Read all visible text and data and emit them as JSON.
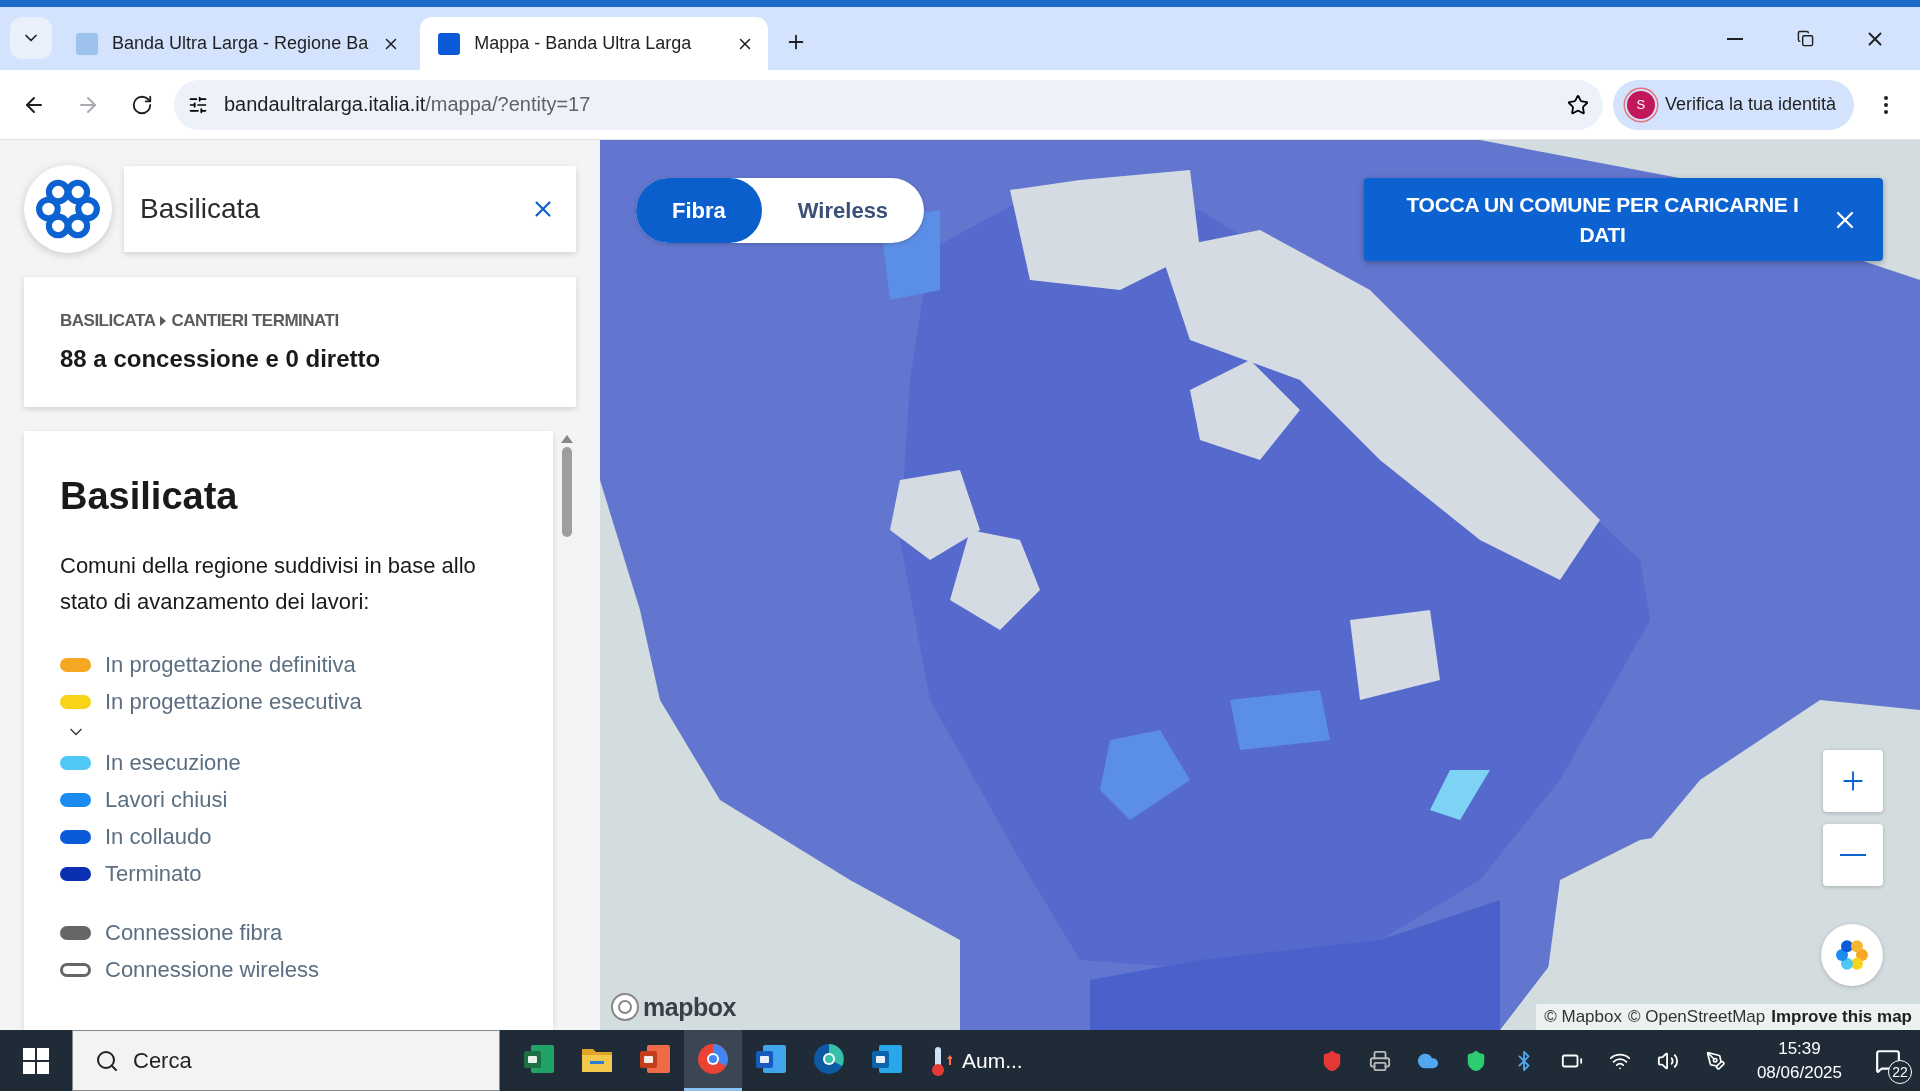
{
  "browser": {
    "tabs": [
      {
        "title": "Banda Ultra Larga - Regione Ba",
        "selected": false
      },
      {
        "title": "Mappa - Banda Ultra Larga",
        "selected": true
      }
    ],
    "url_host": "bandaultralarga.italia.it",
    "url_path": "/mappa/?entity=17",
    "forward_disabled": true,
    "profile": {
      "initial": "S",
      "label": "Verifica la tua identità"
    }
  },
  "sidebar": {
    "search": {
      "value": "Basilicata"
    },
    "summary": {
      "breadcrumb": [
        "BASILICATA",
        "CANTIERI TERMINATI"
      ],
      "text": "88 a concessione e 0 diretto"
    },
    "legend": {
      "title": "Basilicata",
      "description": "Comuni della regione suddivisi in base allo stato di avanzamento dei lavori:",
      "items": [
        {
          "kind": "swatch",
          "label": "In progettazione definitiva",
          "color": "#f5a623"
        },
        {
          "kind": "swatch",
          "label": "In progettazione esecutiva",
          "color": "#f7d417"
        },
        {
          "kind": "toggle",
          "expanded": false
        },
        {
          "kind": "swatch",
          "label": "In esecuzione",
          "color": "#4fc8f5"
        },
        {
          "kind": "swatch",
          "label": "Lavori chiusi",
          "color": "#1a8cf0"
        },
        {
          "kind": "swatch",
          "label": "In collaudo",
          "color": "#0b5bd9"
        },
        {
          "kind": "swatch",
          "label": "Terminato",
          "color": "#0a2fb0"
        }
      ],
      "connections": [
        {
          "kind": "filled",
          "label": "Connessione fibra"
        },
        {
          "kind": "outline",
          "label": "Connessione wireless"
        }
      ]
    }
  },
  "map": {
    "modes": [
      {
        "label": "Fibra",
        "selected": true
      },
      {
        "label": "Wireless",
        "selected": false
      }
    ],
    "banner": "TOCCA UN COMUNE PER CARICARNE I DATI",
    "logo": "mapbox",
    "attribution": [
      "© Mapbox",
      "© OpenStreetMap"
    ],
    "improve_link": "Improve this map"
  },
  "taskbar": {
    "search_placeholder": "Cerca",
    "apps": [
      {
        "kind": "excel",
        "selected": false
      },
      {
        "kind": "folder",
        "selected": false
      },
      {
        "kind": "powerpoint",
        "selected": false
      },
      {
        "kind": "chrome",
        "selected": true
      },
      {
        "kind": "word",
        "selected": false
      },
      {
        "kind": "edge",
        "selected": false
      },
      {
        "kind": "outlook",
        "selected": false
      }
    ],
    "weather": "Aum...",
    "time": "15:39",
    "date": "08/06/2025",
    "notifications": "22"
  }
}
